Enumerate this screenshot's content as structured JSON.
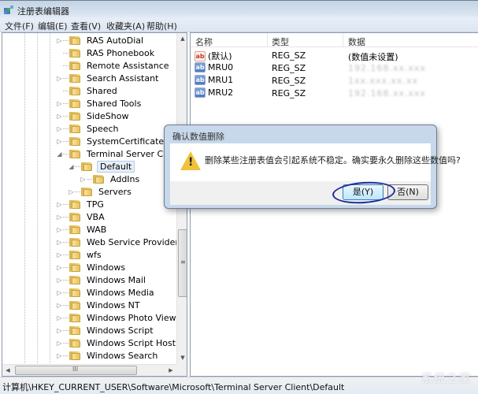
{
  "window": {
    "title": "注册表编辑器"
  },
  "menu": [
    "文件(F)",
    "编辑(E)",
    "查看(V)",
    "收藏夹(A)",
    "帮助(H)"
  ],
  "tree": {
    "items": [
      {
        "label": "RAS AutoDial",
        "level": 0,
        "expander": "collapsed"
      },
      {
        "label": "RAS Phonebook",
        "level": 0,
        "expander": "none"
      },
      {
        "label": "Remote Assistance",
        "level": 0,
        "expander": "none"
      },
      {
        "label": "Search Assistant",
        "level": 0,
        "expander": "collapsed"
      },
      {
        "label": "Shared",
        "level": 0,
        "expander": "none"
      },
      {
        "label": "Shared Tools",
        "level": 0,
        "expander": "collapsed"
      },
      {
        "label": "SideShow",
        "level": 0,
        "expander": "collapsed"
      },
      {
        "label": "Speech",
        "level": 0,
        "expander": "collapsed"
      },
      {
        "label": "SystemCertificates",
        "level": 0,
        "expander": "collapsed"
      },
      {
        "label": "Terminal Server Client",
        "level": 0,
        "expander": "expanded"
      },
      {
        "label": "Default",
        "level": 1,
        "expander": "expanded",
        "selected": true
      },
      {
        "label": "AddIns",
        "level": 2,
        "expander": "collapsed"
      },
      {
        "label": "Servers",
        "level": 1,
        "expander": "collapsed"
      },
      {
        "label": "TPG",
        "level": 0,
        "expander": "collapsed"
      },
      {
        "label": "VBA",
        "level": 0,
        "expander": "collapsed"
      },
      {
        "label": "WAB",
        "level": 0,
        "expander": "collapsed"
      },
      {
        "label": "Web Service Providers",
        "level": 0,
        "expander": "collapsed"
      },
      {
        "label": "wfs",
        "level": 0,
        "expander": "collapsed"
      },
      {
        "label": "Windows",
        "level": 0,
        "expander": "collapsed"
      },
      {
        "label": "Windows Mail",
        "level": 0,
        "expander": "collapsed"
      },
      {
        "label": "Windows Media",
        "level": 0,
        "expander": "collapsed"
      },
      {
        "label": "Windows NT",
        "level": 0,
        "expander": "collapsed"
      },
      {
        "label": "Windows Photo Viewer",
        "level": 0,
        "expander": "collapsed"
      },
      {
        "label": "Windows Script",
        "level": 0,
        "expander": "collapsed"
      },
      {
        "label": "Windows Script Host",
        "level": 0,
        "expander": "collapsed"
      },
      {
        "label": "Windows Search",
        "level": 0,
        "expander": "collapsed"
      }
    ],
    "vscroll_grip": "≡",
    "hscroll_grip": "III"
  },
  "list": {
    "columns": [
      "名称",
      "类型",
      "数据"
    ],
    "rows": [
      {
        "icon": "default",
        "name": "(默认)",
        "type": "REG_SZ",
        "value": "(数值未设置)"
      },
      {
        "icon": "str",
        "name": "MRU0",
        "type": "REG_SZ",
        "value": "192.168.xx.xxx",
        "masked": true
      },
      {
        "icon": "str",
        "name": "MRU1",
        "type": "REG_SZ",
        "value": "1xx.xxx.xx.xx",
        "masked": true
      },
      {
        "icon": "str",
        "name": "MRU2",
        "type": "REG_SZ",
        "value": "192.168.xx.xxx",
        "masked": true
      }
    ]
  },
  "dialog": {
    "title": "确认数值删除",
    "message": "删除某些注册表值会引起系统不稳定。确实要永久删除这些数值吗?",
    "yes_label": "是(Y)",
    "no_label": "否(N)",
    "icon": "warning-icon",
    "warn_mark": "!"
  },
  "status": {
    "path": "计算机\\HKEY_CURRENT_USER\\Software\\Microsoft\\Terminal Server Client\\Default"
  },
  "watermark": "系统之家",
  "glyphs": {
    "collapsed": "▷",
    "expanded": "◢",
    "up": "▲",
    "down": "▼",
    "left": "◀",
    "right": "▶",
    "app_icon": "▦"
  }
}
